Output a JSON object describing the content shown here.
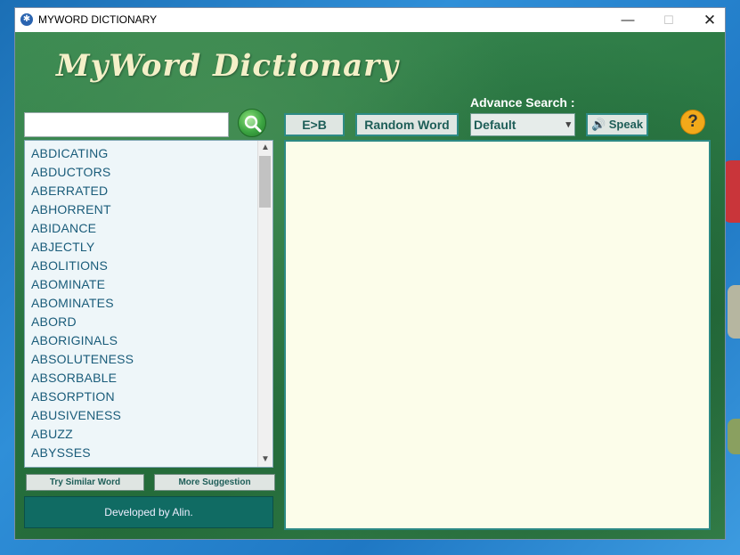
{
  "window": {
    "title": "MYWORD DICTIONARY"
  },
  "header": {
    "logo_text": "MyWord Dictionary"
  },
  "search": {
    "value": "",
    "placeholder": ""
  },
  "word_list": {
    "items": [
      "ABDICATING",
      "ABDUCTORS",
      "ABERRATED",
      "ABHORRENT",
      "ABIDANCE",
      "ABJECTLY",
      "ABOLITIONS",
      "ABOMINATE",
      "ABOMINATES",
      "ABORD",
      "ABORIGINALS",
      "ABSOLUTENESS",
      "ABSORBABLE",
      "ABSORPTION",
      "ABUSIVENESS",
      "ABUZZ",
      "ABYSSES"
    ]
  },
  "buttons": {
    "try_similar": "Try Similar Word",
    "more_suggestion": "More Suggestion",
    "eb": "E>B",
    "random_word": "Random Word",
    "speak": "Speak",
    "help": "?"
  },
  "advance_search": {
    "label": "Advance Search :",
    "selected": "Default"
  },
  "footer": {
    "developer": "Developed by Alin."
  },
  "colors": {
    "accent": "#2d8a85",
    "background_green": "#2c7a45",
    "result_bg": "#fcfdea",
    "dev_box": "#106b63",
    "help": "#f2a91a"
  }
}
